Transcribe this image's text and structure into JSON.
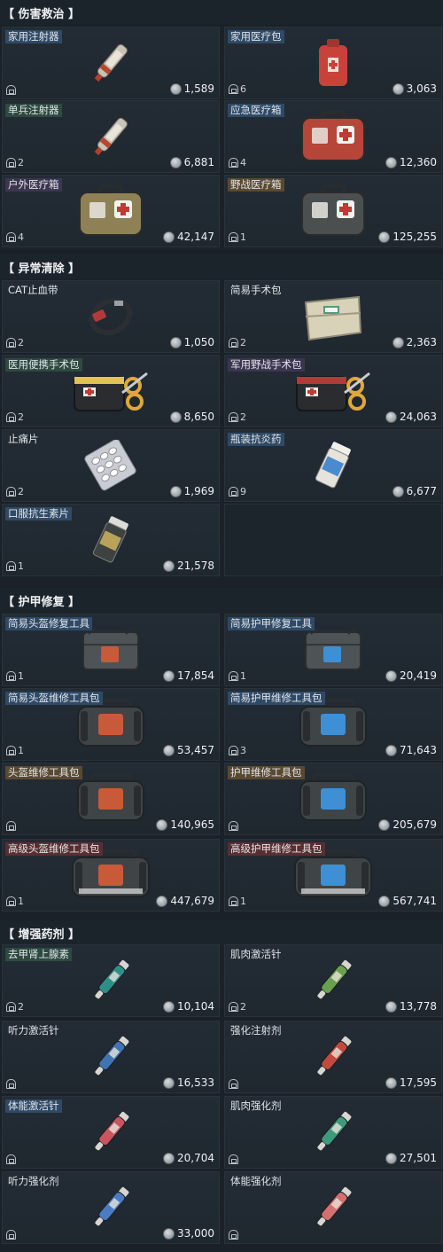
{
  "sections": [
    {
      "title": "【 伤害救治 】",
      "items": [
        {
          "name": "家用注射器",
          "quality": "blue",
          "count": "",
          "price": "1,589",
          "icon": "syringe-icon"
        },
        {
          "name": "家用医疗包",
          "quality": "blue",
          "count": "6",
          "price": "3,063",
          "icon": "first-aid-pouch-icon"
        },
        {
          "name": "单兵注射器",
          "quality": "green",
          "count": "2",
          "price": "6,881",
          "icon": "syringe-icon"
        },
        {
          "name": "应急医疗箱",
          "quality": "blue",
          "count": "4",
          "price": "12,360",
          "icon": "medkit-icon"
        },
        {
          "name": "户外医疗箱",
          "quality": "purple",
          "count": "4",
          "price": "42,147",
          "icon": "medkit-icon"
        },
        {
          "name": "野战医疗箱",
          "quality": "gold",
          "count": "1",
          "price": "125,255",
          "icon": "medkit-icon"
        }
      ]
    },
    {
      "title": "【 异常清除 】",
      "items": [
        {
          "name": "CAT止血带",
          "quality": "none",
          "count": "2",
          "price": "1,050",
          "icon": "tourniquet-icon"
        },
        {
          "name": "简易手术包",
          "quality": "none",
          "count": "2",
          "price": "2,363",
          "icon": "surgery-kit-icon"
        },
        {
          "name": "医用便携手术包",
          "quality": "green",
          "count": "2",
          "price": "8,650",
          "icon": "surgery-bag-icon"
        },
        {
          "name": "军用野战手术包",
          "quality": "purple",
          "count": "2",
          "price": "24,063",
          "icon": "surgery-bag-icon"
        },
        {
          "name": "止痛片",
          "quality": "none",
          "count": "2",
          "price": "1,969",
          "icon": "pill-pack-icon"
        },
        {
          "name": "瓶装抗炎药",
          "quality": "blue",
          "count": "9",
          "price": "6,677",
          "icon": "pill-bottle-icon"
        },
        {
          "name": "口服抗生素片",
          "quality": "blue",
          "count": "1",
          "price": "21,578",
          "icon": "pill-bottle-icon"
        }
      ]
    },
    {
      "title": "【 护甲修复 】",
      "items": [
        {
          "name": "简易头盔修复工具",
          "quality": "blue",
          "count": "1",
          "price": "17,854",
          "icon": "repair-pouch-icon"
        },
        {
          "name": "简易护甲修复工具",
          "quality": "blue",
          "count": "1",
          "price": "20,419",
          "icon": "repair-pouch-icon"
        },
        {
          "name": "简易头盔维修工具包",
          "quality": "blue",
          "count": "1",
          "price": "53,457",
          "icon": "repair-bag-icon"
        },
        {
          "name": "简易护甲维修工具包",
          "quality": "blue",
          "count": "3",
          "price": "71,643",
          "icon": "repair-bag-icon"
        },
        {
          "name": "头盔维修工具包",
          "quality": "gold",
          "count": "",
          "price": "140,965",
          "icon": "repair-bag-icon"
        },
        {
          "name": "护甲维修工具包",
          "quality": "gold",
          "count": "",
          "price": "205,679",
          "icon": "repair-bag-icon"
        },
        {
          "name": "高级头盔维修工具包",
          "quality": "red",
          "count": "1",
          "price": "447,679",
          "icon": "repair-bag-icon"
        },
        {
          "name": "高级护甲维修工具包",
          "quality": "red",
          "count": "1",
          "price": "567,741",
          "icon": "repair-bag-icon"
        }
      ]
    },
    {
      "title": "【 增强药剂 】",
      "items": [
        {
          "name": "去甲肾上腺素",
          "quality": "green",
          "count": "2",
          "price": "10,104",
          "icon": "injector-icon"
        },
        {
          "name": "肌肉激活针",
          "quality": "none",
          "count": "2",
          "price": "13,778",
          "icon": "injector-icon"
        },
        {
          "name": "听力激活针",
          "quality": "none",
          "count": "",
          "price": "16,533",
          "icon": "injector-icon"
        },
        {
          "name": "强化注射剂",
          "quality": "none",
          "count": "",
          "price": "17,595",
          "icon": "injector-icon"
        },
        {
          "name": "体能激活针",
          "quality": "blue",
          "count": "",
          "price": "20,704",
          "icon": "injector-icon"
        },
        {
          "name": "肌肉强化剂",
          "quality": "none",
          "count": "",
          "price": "27,501",
          "icon": "injector-icon"
        },
        {
          "name": "听力强化剂",
          "quality": "none",
          "count": "",
          "price": "33,000",
          "icon": "injector-icon"
        },
        {
          "name": "体能强化剂",
          "quality": "none",
          "count": "",
          "price": "",
          "icon": "injector-icon"
        }
      ]
    }
  ]
}
